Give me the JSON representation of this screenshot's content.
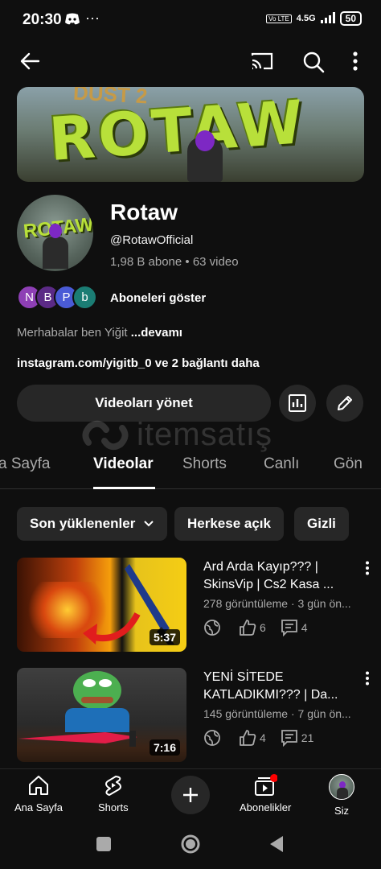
{
  "status": {
    "time": "20:30",
    "network": "4.5G",
    "battery": "50"
  },
  "channel": {
    "banner_top": "DUST 2",
    "banner_text": "ROTAW",
    "avatar_text": "ROTAW",
    "name": "Rotaw",
    "handle": "@RotawOfficial",
    "stats": "1,98 B abone • 63 video",
    "subscribers_label": "Aboneleri göster",
    "subscriber_initials": [
      {
        "letter": "N",
        "color": "#8e3fb5"
      },
      {
        "letter": "B",
        "color": "#5b2a86"
      },
      {
        "letter": "P",
        "color": "#4a5bd6"
      },
      {
        "letter": "b",
        "color": "#1b7d74"
      }
    ],
    "description": "Merhabalar ben Yiğit",
    "description_more": " ...devamı",
    "link": "instagram.com/yigitb_0",
    "link_more": " ve 2 bağlantı daha",
    "manage_label": "Videoları yönet"
  },
  "watermark": {
    "text": "itemsatış"
  },
  "tabs": [
    "a Sayfa",
    "Videolar",
    "Shorts",
    "Canlı",
    "Gön"
  ],
  "chips": [
    "Son yüklenenler",
    "Herkese açık",
    "Gizli"
  ],
  "videos": [
    {
      "title_line1": "Ard Arda Kayıp??? |",
      "title_line2": "SkinsVip | Cs2 Kasa ...",
      "meta": "278 görüntüleme · 3 gün ön...",
      "duration": "5:37",
      "likes": "6",
      "comments": "4"
    },
    {
      "title_line1": "YENİ SİTEDE",
      "title_line2": "KATLADIKMI??? | Da...",
      "meta": "145 görüntüleme · 7 gün ön...",
      "duration": "7:16",
      "likes": "4",
      "comments": "21"
    }
  ],
  "bottom_nav": {
    "home": "Ana Sayfa",
    "shorts": "Shorts",
    "subscriptions": "Abonelikler",
    "you": "Siz"
  },
  "colors": {
    "background": "#0f0f0f",
    "surface": "#272727",
    "badge": "#ff0000"
  }
}
